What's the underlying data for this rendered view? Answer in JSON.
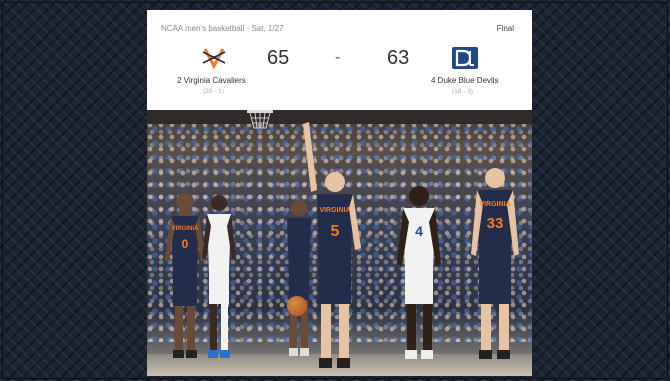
{
  "scoreboard": {
    "meta": "NCAA men's basketball · Sat, 1/27",
    "status": "Final",
    "separator": "-",
    "home": {
      "rank": "2",
      "name": "2 Virginia Cavaliers",
      "record": "(20 - 1)",
      "score": "65",
      "logo_icon": "virginia-cavaliers-logo-icon",
      "color": "#f47b20"
    },
    "away": {
      "rank": "4",
      "name": "4 Duke Blue Devils",
      "record": "(18 - 3)",
      "score": "63",
      "logo_icon": "duke-blue-devils-logo-icon",
      "color": "#1f4a8a"
    }
  },
  "photo": {
    "jerseys": [
      {
        "team": "VIRGINIA",
        "number": "0"
      },
      {
        "team": "VIRGINIA",
        "number": "5"
      },
      {
        "team": "VIRGINIA",
        "number": "33"
      },
      {
        "team": "DUKE",
        "number": "4"
      }
    ]
  },
  "colors": {
    "uva_navy": "#232d4b",
    "uva_orange": "#f47b20",
    "duke_blue": "#1f4a8a"
  }
}
